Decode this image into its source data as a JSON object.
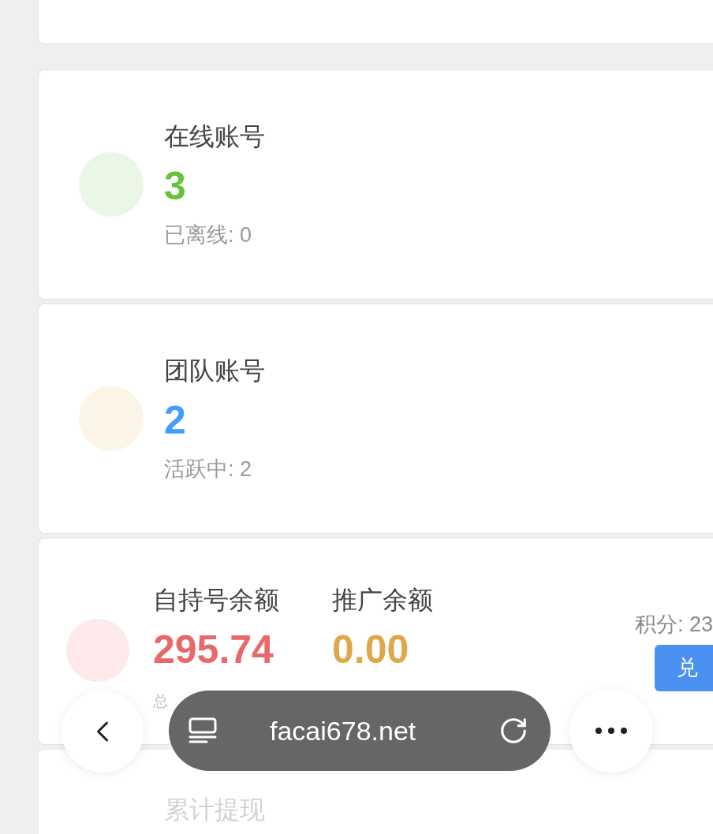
{
  "cards": [
    {
      "kind": "blank"
    },
    {
      "kind": "stat",
      "icon": {
        "color": "#eaf6e6"
      },
      "title": "在线账号",
      "value": {
        "text": "3",
        "color": "#67c23a"
      },
      "detail": "已离线: 0"
    },
    {
      "kind": "stat",
      "icon": {
        "color": "#fdf4e8"
      },
      "title": "团队账号",
      "value": {
        "text": "2",
        "color": "#409eff"
      },
      "detail": "活跃中: 2"
    },
    {
      "kind": "balance",
      "icon": {
        "color": "#fde9e9"
      },
      "balances": [
        {
          "label": "自持号余额",
          "value": {
            "text": "295.74",
            "color": "#e8696b"
          }
        },
        {
          "label": "推广余额",
          "value": {
            "text": "0.00",
            "color": "#dea84a"
          }
        }
      ],
      "points": "积分: 23",
      "button": "兑",
      "footer": "总"
    },
    {
      "kind": "summary",
      "title": "累计提现"
    }
  ],
  "browser_bar": {
    "url": "facai678.net"
  }
}
